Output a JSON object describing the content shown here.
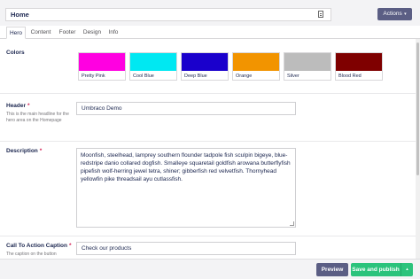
{
  "header": {
    "node_name": "Home",
    "actions_label": "Actions"
  },
  "tabs": [
    {
      "label": "Hero"
    },
    {
      "label": "Content"
    },
    {
      "label": "Footer"
    },
    {
      "label": "Design"
    },
    {
      "label": "Info"
    }
  ],
  "colors": {
    "label": "Colors",
    "swatches": [
      {
        "label": "Pretty Pink",
        "hex": "#ff00e1"
      },
      {
        "label": "Cool Blue",
        "hex": "#00e8f2"
      },
      {
        "label": "Deep Blue",
        "hex": "#1a00cc"
      },
      {
        "label": "Orange",
        "hex": "#f29400"
      },
      {
        "label": "Silver",
        "hex": "#bcbcbc"
      },
      {
        "label": "Blood Red",
        "hex": "#7f0000"
      }
    ]
  },
  "header_field": {
    "label": "Header",
    "description": "This is the main headline for the hero area on the Homepage",
    "value": "Umbraco Demo"
  },
  "description_field": {
    "label": "Description",
    "value": "Moonfish, steelhead, lamprey southern flounder tadpole fish sculpin bigeye, blue-redstripe danio collared dogfish. Smalleye squaretail goldfish arowana butterflyfish pipefish wolf-herring jewel tetra, shiner; gibberfish red velvetfish. Thornyhead yellowfin pike threadsail ayu cutlassfish."
  },
  "cta_caption_field": {
    "label": "Call To Action Caption",
    "description": "The caption on the button",
    "value": "Check our products"
  },
  "footer": {
    "preview_label": "Preview",
    "publish_label": "Save and publish"
  },
  "required_marker": "*"
}
